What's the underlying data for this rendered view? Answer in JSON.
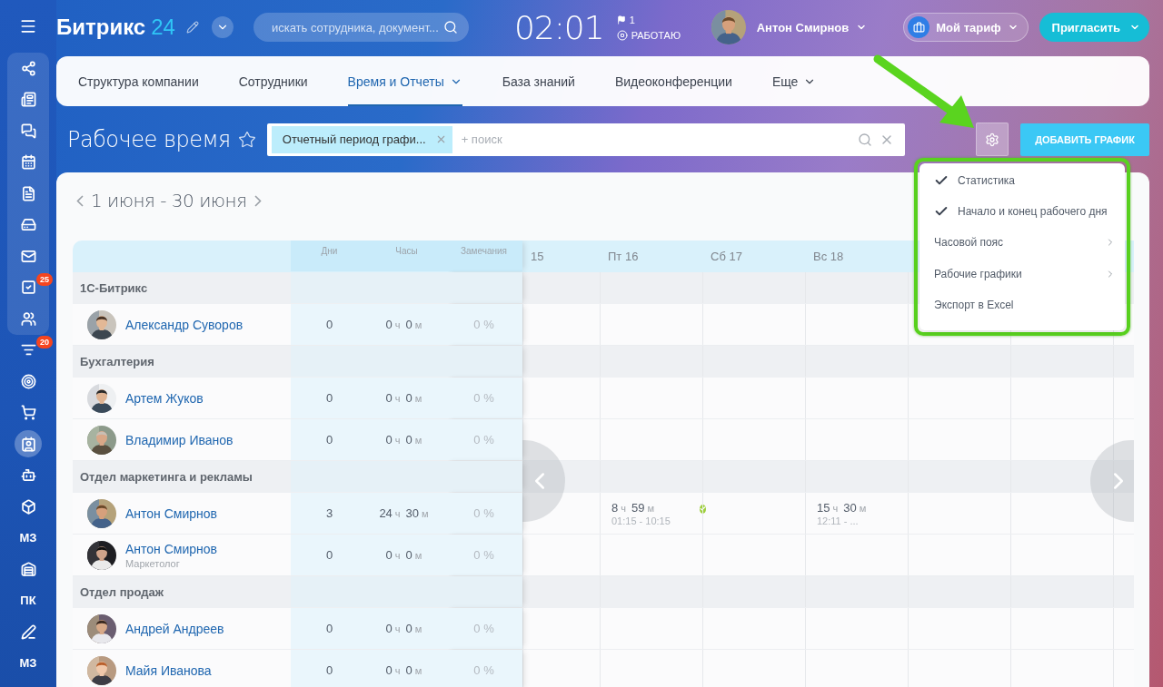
{
  "sidebar": {
    "pinned": [
      {
        "kind": "icon",
        "selected": false
      },
      {
        "kind": "icon",
        "selected": false
      },
      {
        "kind": "icon",
        "selected": false
      },
      {
        "kind": "icon",
        "selected": false
      },
      {
        "kind": "icon",
        "selected": false
      },
      {
        "kind": "icon",
        "selected": false
      },
      {
        "kind": "icon",
        "selected": false
      },
      {
        "kind": "icon",
        "selected": false,
        "badge": "25"
      },
      {
        "kind": "icon",
        "selected": false
      }
    ],
    "items": [
      {
        "kind": "icon",
        "selected": false,
        "badge": "20"
      },
      {
        "kind": "icon",
        "selected": false
      },
      {
        "kind": "icon",
        "selected": false
      },
      {
        "kind": "icon",
        "selected": true
      },
      {
        "kind": "icon",
        "selected": false
      },
      {
        "kind": "icon",
        "selected": false
      },
      {
        "kind": "text",
        "label": "МЗ",
        "selected": false
      },
      {
        "kind": "icon",
        "selected": false
      },
      {
        "kind": "text",
        "label": "ПК",
        "selected": false
      },
      {
        "kind": "icon",
        "selected": false
      },
      {
        "kind": "text",
        "label": "МЗ",
        "selected": false
      }
    ]
  },
  "header": {
    "logo": {
      "name": "Битрикс",
      "number": "24"
    },
    "search": {
      "placeholder": "искать сотрудника, документ..."
    },
    "clock": "02:01",
    "flag_count": "1",
    "status": "РАБОТАЮ",
    "user": "Антон Смирнов",
    "tariff": "Мой тариф",
    "invite": "Пригласить"
  },
  "nav_tabs": [
    {
      "label": "Структура компании",
      "selected": false,
      "has_menu": false
    },
    {
      "label": "Сотрудники",
      "selected": false,
      "has_menu": false
    },
    {
      "label": "Время и Отчеты",
      "selected": true,
      "has_menu": true
    },
    {
      "label": "База знаний",
      "selected": false,
      "has_menu": false
    },
    {
      "label": "Видеоконференции",
      "selected": false,
      "has_menu": false
    },
    {
      "label": "Еще",
      "selected": false,
      "has_menu": true
    }
  ],
  "page": {
    "title": "Рабочее время",
    "starred": false
  },
  "filter": {
    "tag": "Отчетный период графи...",
    "placeholder": "+ поиск"
  },
  "add_button": "ДОБАВИТЬ ГРАФИК",
  "period": "1 июня - 30 июня",
  "table": {
    "stat_columns": [
      "Дни",
      "Часы",
      "Замечания"
    ],
    "day_columns": [
      "15",
      "Пт 16",
      "Сб 17",
      "Вс 18"
    ],
    "rows": [
      {
        "kind": "group",
        "label": "1С-Битрикс"
      },
      {
        "kind": "person",
        "name": "Александр Суворов",
        "days": "0",
        "hours": [
          "0",
          "ч",
          "0",
          "м"
        ],
        "remarks": "0 %"
      },
      {
        "kind": "group",
        "label": "Бухгалтерия"
      },
      {
        "kind": "person",
        "name": "Артем Жуков",
        "days": "0",
        "hours": [
          "0",
          "ч",
          "0",
          "м"
        ],
        "remarks": "0 %"
      },
      {
        "kind": "person",
        "name": "Владимир Иванов",
        "days": "0",
        "hours": [
          "0",
          "ч",
          "0",
          "м"
        ],
        "remarks": "0 %"
      },
      {
        "kind": "group",
        "label": "Отдел маркетинга и рекламы"
      },
      {
        "kind": "person",
        "name": "Антон Смирнов",
        "days": "3",
        "hours": [
          "24",
          "ч",
          "30",
          "м"
        ],
        "remarks": "0 %",
        "day_cells": [
          null,
          {
            "hours": [
              "8",
              "ч",
              "59",
              "м"
            ],
            "range": "01:15 - 10:15",
            "confirmed": true
          },
          null,
          {
            "hours": [
              "15",
              "ч",
              "30",
              "м"
            ],
            "range": "12:11 - ...",
            "confirmed": false
          }
        ]
      },
      {
        "kind": "person",
        "name": "Антон Смирнов",
        "position": "Маркетолог",
        "days": "0",
        "hours": [
          "0",
          "ч",
          "0",
          "м"
        ],
        "remarks": "0 %"
      },
      {
        "kind": "group",
        "label": "Отдел продаж"
      },
      {
        "kind": "person",
        "name": "Андрей Андреев",
        "days": "0",
        "hours": [
          "0",
          "ч",
          "0",
          "м"
        ],
        "remarks": "0 %"
      },
      {
        "kind": "person",
        "name": "Майя Иванова",
        "days": "0",
        "hours": [
          "0",
          "ч",
          "0",
          "м"
        ],
        "remarks": "0 %"
      }
    ]
  },
  "menu": {
    "items": [
      {
        "kind": "option",
        "label": "Статистика",
        "checked": true
      },
      {
        "kind": "option",
        "label": "Начало и конец рабочего дня",
        "checked": true
      },
      {
        "kind": "submenu",
        "label": "Часовой пояс"
      },
      {
        "kind": "submenu",
        "label": "Рабочие графики"
      },
      {
        "kind": "action",
        "label": "Экспорт в Excel"
      }
    ]
  }
}
